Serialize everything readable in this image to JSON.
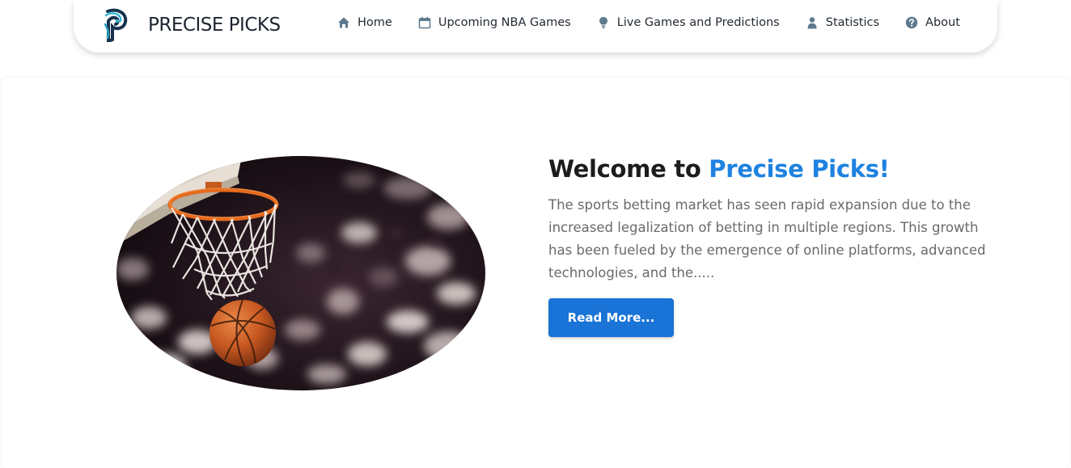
{
  "brand": {
    "name": "PRECISE PICKS",
    "logo": "precise-picks-logo"
  },
  "nav": {
    "items": [
      {
        "label": "Home",
        "icon": "home-icon"
      },
      {
        "label": "Upcoming NBA Games",
        "icon": "calendar-icon"
      },
      {
        "label": "Live Games and Predictions",
        "icon": "lightbulb-icon"
      },
      {
        "label": "Statistics",
        "icon": "user-icon"
      },
      {
        "label": "About",
        "icon": "question-circle-icon"
      }
    ]
  },
  "hero": {
    "title_prefix": "Welcome to",
    "title_accent": "Precise Picks!",
    "description": "The sports betting market has seen rapid expansion due to the increased legalization of betting in multiple regions. This growth has been fueled by the emergence of online platforms, advanced technologies, and the.....",
    "button_label": "Read More..."
  },
  "colors": {
    "accent": "#1e82e0",
    "button": "#1a73d6",
    "nav_icon": "#5e7a8e"
  }
}
